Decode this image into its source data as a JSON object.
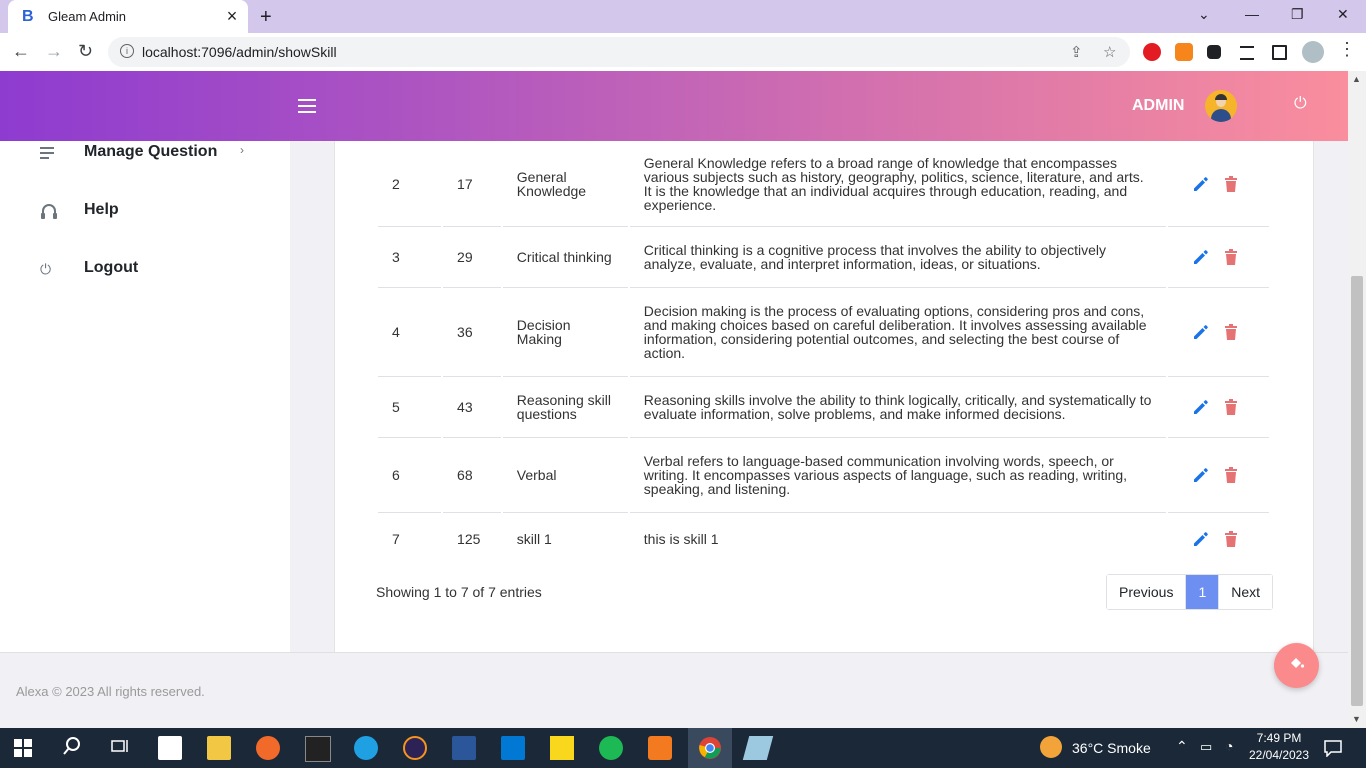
{
  "browser": {
    "tab_title": "Gleam Admin",
    "tab_favicon": "B",
    "new_tab": "+",
    "url": "localhost:7096/admin/showSkill"
  },
  "header": {
    "admin_label": "ADMIN"
  },
  "sidebar": {
    "items": [
      {
        "label": "Manage Question",
        "icon": "list-icon",
        "has_chevron": true,
        "chevron": "›"
      },
      {
        "label": "Help",
        "icon": "headset-icon"
      },
      {
        "label": "Logout",
        "icon": "power-icon"
      }
    ]
  },
  "table": {
    "rows": [
      {
        "index": "2",
        "id": "17",
        "name": "General Knowledge",
        "description": "General Knowledge refers to a broad range of knowledge that encompasses various subjects such as history, geography, politics, science, literature, and arts. It is the knowledge that an individual acquires through education, reading, and experience."
      },
      {
        "index": "3",
        "id": "29",
        "name": "Critical thinking",
        "description": "Critical thinking is a cognitive process that involves the ability to objectively analyze, evaluate, and interpret information, ideas, or situations."
      },
      {
        "index": "4",
        "id": "36",
        "name": "Decision Making",
        "description": "Decision making is the process of evaluating options, considering pros and cons, and making choices based on careful deliberation. It involves assessing available information, considering potential outcomes, and selecting the best course of action."
      },
      {
        "index": "5",
        "id": "43",
        "name": "Reasoning skill questions",
        "description": "Reasoning skills involve the ability to think logically, critically, and systematically to evaluate information, solve problems, and make informed decisions."
      },
      {
        "index": "6",
        "id": "68",
        "name": "Verbal",
        "description": "Verbal refers to language-based communication involving words, speech, or writing. It encompasses various aspects of language, such as reading, writing, speaking, and listening."
      },
      {
        "index": "7",
        "id": "125",
        "name": "skill 1",
        "description": "this is skill 1"
      }
    ]
  },
  "pagination": {
    "info": "Showing 1 to 7 of 7 entries",
    "previous": "Previous",
    "current": "1",
    "next": "Next"
  },
  "footer": {
    "text": "Alexa © 2023 All rights reserved."
  },
  "taskbar": {
    "weather": "36°C  Smoke",
    "time": "7:49 PM",
    "date": "22/04/2023"
  },
  "colors": {
    "edit": "#1a73e8",
    "delete": "#e57373",
    "accent": "#6d8ff1"
  }
}
